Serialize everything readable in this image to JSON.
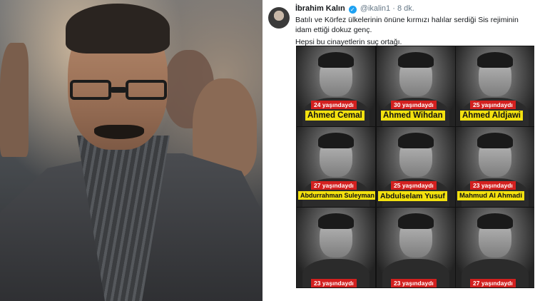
{
  "tweet": {
    "author_name": "İbrahim Kalın",
    "author_handle": "@ikalin1",
    "time": "8 dk.",
    "text_line1": "Batılı ve Körfez ülkelerinin önüne kırmızı halılar serdiği Sis rejiminin idam ettiği dokuz genç.",
    "text_line2": "Hepsi bu cinayetlerin suç ortağı."
  },
  "victims": [
    {
      "age": "24 yaşındaydı",
      "name": "Ahmed Cemal"
    },
    {
      "age": "30 yaşındaydı",
      "name": "Ahmed Wihdan"
    },
    {
      "age": "25 yaşındaydı",
      "name": "Ahmed Aldjawi"
    },
    {
      "age": "27 yaşındaydı",
      "name": "Abdurrahman Suleyman"
    },
    {
      "age": "25 yaşındaydı",
      "name": "Abdulselam Yusuf"
    },
    {
      "age": "23 yaşındaydı",
      "name": "Mahmud Al Ahmadi"
    },
    {
      "age": "23 yaşındaydı",
      "name": ""
    },
    {
      "age": "23 yaşındaydı",
      "name": ""
    },
    {
      "age": "27 yaşındaydı",
      "name": ""
    }
  ],
  "colors": {
    "age_badge": "#d3201f",
    "name_badge": "#f3e10f",
    "verified": "#1da1f2"
  }
}
